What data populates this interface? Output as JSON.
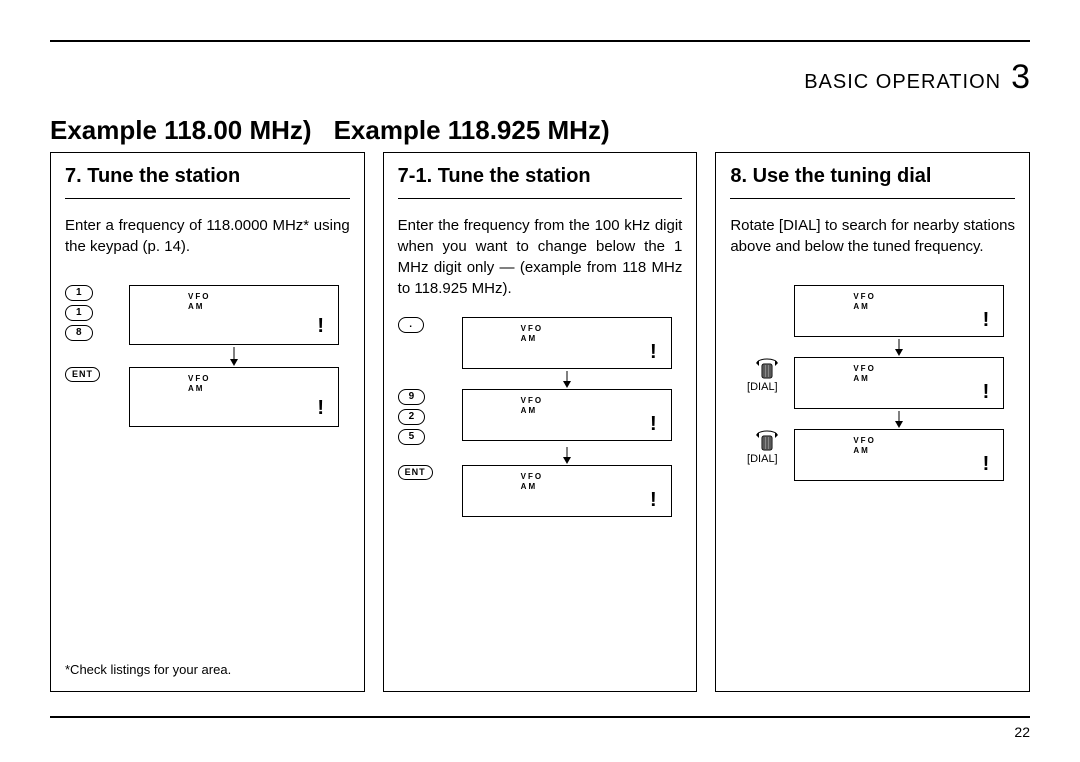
{
  "header": {
    "section_label": "BASIC OPERATION",
    "chapter_number": "3"
  },
  "examples": {
    "left": "Example 118.00 MHz)",
    "right": "Example 118.925 MHz)"
  },
  "columns": [
    {
      "title": "7. Tune the station",
      "body": "Enter a frequency of 118.0000 MHz* using the keypad (p. 14).",
      "footnote": "*Check listings for your area.",
      "steps": [
        {
          "keys": [
            "1",
            "1",
            "8"
          ],
          "lcd": {
            "line1": "VFO",
            "line2": "AM",
            "bang": "!"
          }
        },
        {
          "keys": [
            "ENT"
          ],
          "lcd": {
            "line1": "VFO",
            "line2": "AM",
            "bang": "!"
          }
        }
      ]
    },
    {
      "title": "7-1. Tune the station",
      "body": "Enter the frequency from the 100 kHz digit when you want to change below the 1 MHz digit only — (example from 118 MHz to 118.925 MHz).",
      "steps": [
        {
          "keys": [
            "."
          ],
          "lcd": {
            "line1": "VFO",
            "line2": "AM",
            "bang": "!"
          }
        },
        {
          "keys": [
            "9",
            "2",
            "5"
          ],
          "lcd": {
            "line1": "VFO",
            "line2": "AM",
            "bang": "!"
          }
        },
        {
          "keys": [
            "ENT"
          ],
          "lcd": {
            "line1": "VFO",
            "line2": "AM",
            "bang": "!"
          }
        }
      ]
    },
    {
      "title": "8. Use the tuning dial",
      "body": "Rotate [DIAL] to search for nearby stations above and below the tuned frequency.",
      "steps": [
        {
          "dial_label": "[DIAL]",
          "lcd": {
            "line1": "VFO",
            "line2": "AM",
            "bang": "!"
          }
        },
        {
          "dial_label": "[DIAL]",
          "lcd": {
            "line1": "VFO",
            "line2": "AM",
            "bang": "!"
          }
        },
        {
          "lcd": {
            "line1": "VFO",
            "line2": "AM",
            "bang": "!"
          }
        }
      ]
    }
  ],
  "page_number": "22"
}
